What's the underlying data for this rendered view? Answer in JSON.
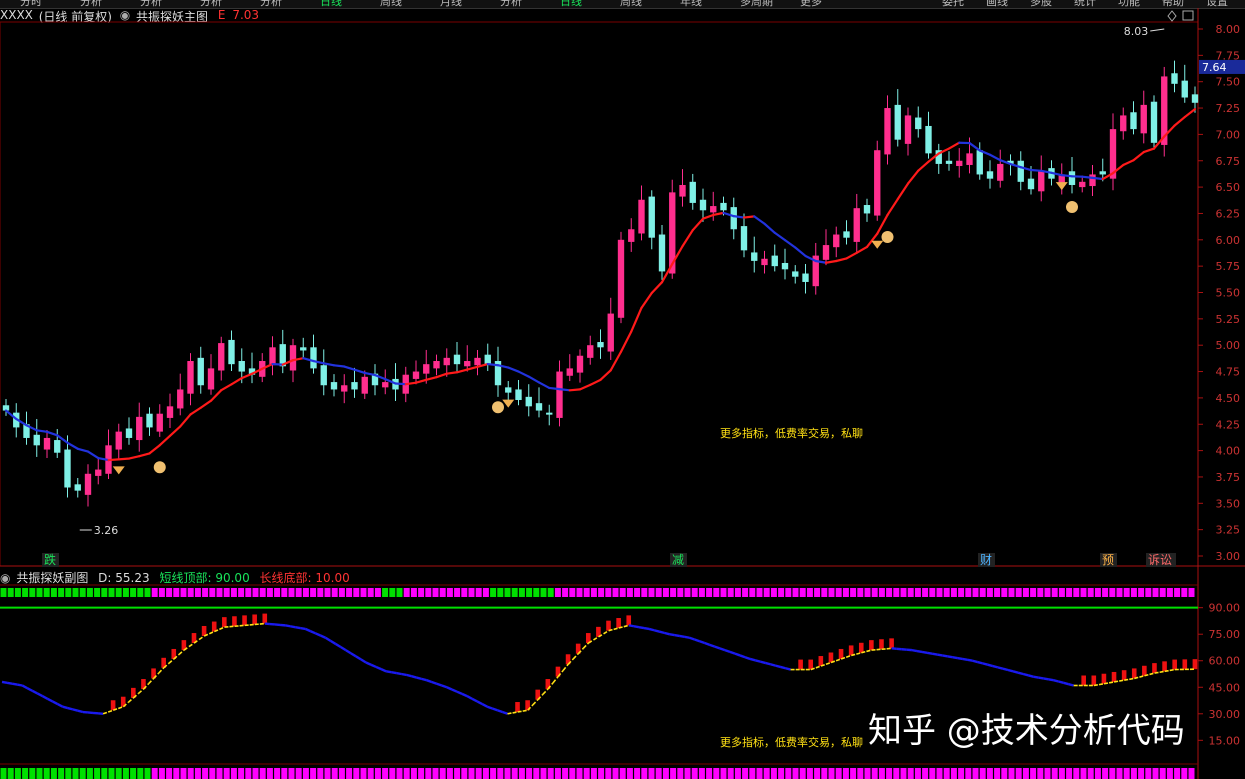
{
  "top_tabs": [
    "分时",
    "分析",
    "分析",
    "分析",
    "分析",
    "日线",
    "周线",
    "月线",
    "分析",
    "日线",
    "周线",
    "年线",
    "多周期",
    "更多"
  ],
  "top_right": [
    "委托",
    "画线",
    "多股",
    "统计",
    "功能",
    "帮助",
    "设置"
  ],
  "main": {
    "stock_name": "XXXX",
    "period": "(日线 前复权)",
    "indicator_name": "共振探妖主图",
    "price_label": "E",
    "price_value": "7.03",
    "current_price_tag": "7.64",
    "high_label": "8.03",
    "low_label": "3.26",
    "promo_text": "更多指标，低费率交易，私聊",
    "axis_ticks": [
      "8.00",
      "7.75",
      "7.50",
      "7.25",
      "7.00",
      "6.75",
      "6.50",
      "6.25",
      "6.00",
      "5.75",
      "5.50",
      "5.25",
      "5.00",
      "4.75",
      "4.50",
      "4.25",
      "4.00",
      "3.75",
      "3.50",
      "3.25",
      "3.00"
    ],
    "event_labels": [
      {
        "text": "跌",
        "color": "#19e35a"
      },
      {
        "text": "减",
        "color": "#19e35a"
      },
      {
        "text": "财",
        "color": "#4db4ff"
      },
      {
        "text": "预",
        "color": "#ffb347"
      },
      {
        "text": "诉讼",
        "color": "#ff6a6a"
      }
    ]
  },
  "sub": {
    "indicator_name": "共振探妖副图",
    "d_label": "D:",
    "d_value": "55.23",
    "top_label": "短线顶部:",
    "top_value": "90.00",
    "bottom_label": "长线底部:",
    "bottom_value": "10.00",
    "promo_text": "更多指标，低费率交易，私聊",
    "axis_ticks": [
      "90.00",
      "75.00",
      "60.00",
      "45.00",
      "30.00",
      "15.00"
    ]
  },
  "watermark": "知乎 @技术分析代码",
  "colors": {
    "up": "#ff2e8e",
    "down": "#7ff0e6",
    "ma_up": "#ff1a1a",
    "ma_down": "#2233dd",
    "grid": "#7a0000",
    "axis_text": "#cc3333",
    "yellow": "#ffe014",
    "green_band": "#00e000",
    "magenta_band": "#ff00ff"
  },
  "chart_data": [
    {
      "type": "candlestick",
      "title": "共振探妖主图",
      "ylim": [
        3.0,
        8.0
      ],
      "annotations": [
        "8.03",
        "3.26",
        "7.64"
      ],
      "series": [
        {
          "name": "",
          "values": [
            4.38,
            4.22,
            4.12,
            4.05,
            4.12,
            3.98,
            3.65,
            3.62,
            3.78,
            3.82,
            4.05,
            4.18,
            4.12,
            4.32,
            4.22,
            4.35,
            4.42,
            4.58,
            4.85,
            4.62,
            4.78,
            5.02,
            4.82,
            4.75,
            4.72,
            4.85,
            4.98,
            4.8,
            5.0,
            4.95,
            4.78,
            4.62,
            4.58,
            4.62,
            4.58,
            4.7,
            4.62,
            4.65,
            4.58,
            4.72,
            4.75,
            4.82,
            4.85,
            4.88,
            4.82,
            4.85,
            4.88,
            4.82,
            4.62,
            4.55,
            4.48,
            4.42,
            4.38,
            4.35,
            4.75,
            4.78,
            4.9,
            5.0,
            4.98,
            5.3,
            6.0,
            6.1,
            6.38,
            6.02,
            5.7,
            6.45,
            6.52,
            6.35,
            6.28,
            6.32,
            6.28,
            6.1,
            5.9,
            5.8,
            5.82,
            5.75,
            5.72,
            5.65,
            5.6,
            5.85,
            5.95,
            6.05,
            6.02,
            6.3,
            6.25,
            6.85,
            7.25,
            6.95,
            7.18,
            7.05,
            6.82,
            6.72,
            6.72,
            6.75,
            6.82,
            6.62,
            6.58,
            6.72,
            6.72,
            6.55,
            6.48,
            6.65,
            6.58,
            6.62,
            6.52,
            6.55,
            6.62,
            6.62,
            7.05,
            7.18,
            7.05,
            7.28,
            6.92,
            7.55,
            7.48,
            7.35,
            7.3
          ]
        }
      ]
    },
    {
      "type": "area",
      "title": "共振探妖副图",
      "ylim": [
        5,
        100
      ],
      "series": [
        {
          "name": "D",
          "values": [
            48,
            46,
            40,
            34,
            31,
            30,
            34,
            44,
            56,
            66,
            74,
            79,
            80,
            81,
            80,
            78,
            73,
            66,
            59,
            54,
            52,
            49,
            45,
            40,
            34,
            30,
            32,
            44,
            58,
            70,
            77,
            80,
            78,
            75,
            73,
            69,
            65,
            61,
            58,
            55,
            55,
            59,
            63,
            66,
            67,
            66,
            64,
            62,
            60,
            57,
            54,
            51,
            49,
            46,
            46,
            48,
            50,
            53,
            55,
            55.23
          ]
        },
        {
          "name": "短线顶部",
          "values": [
            90
          ]
        },
        {
          "name": "长线底部",
          "values": [
            10
          ]
        }
      ]
    }
  ]
}
